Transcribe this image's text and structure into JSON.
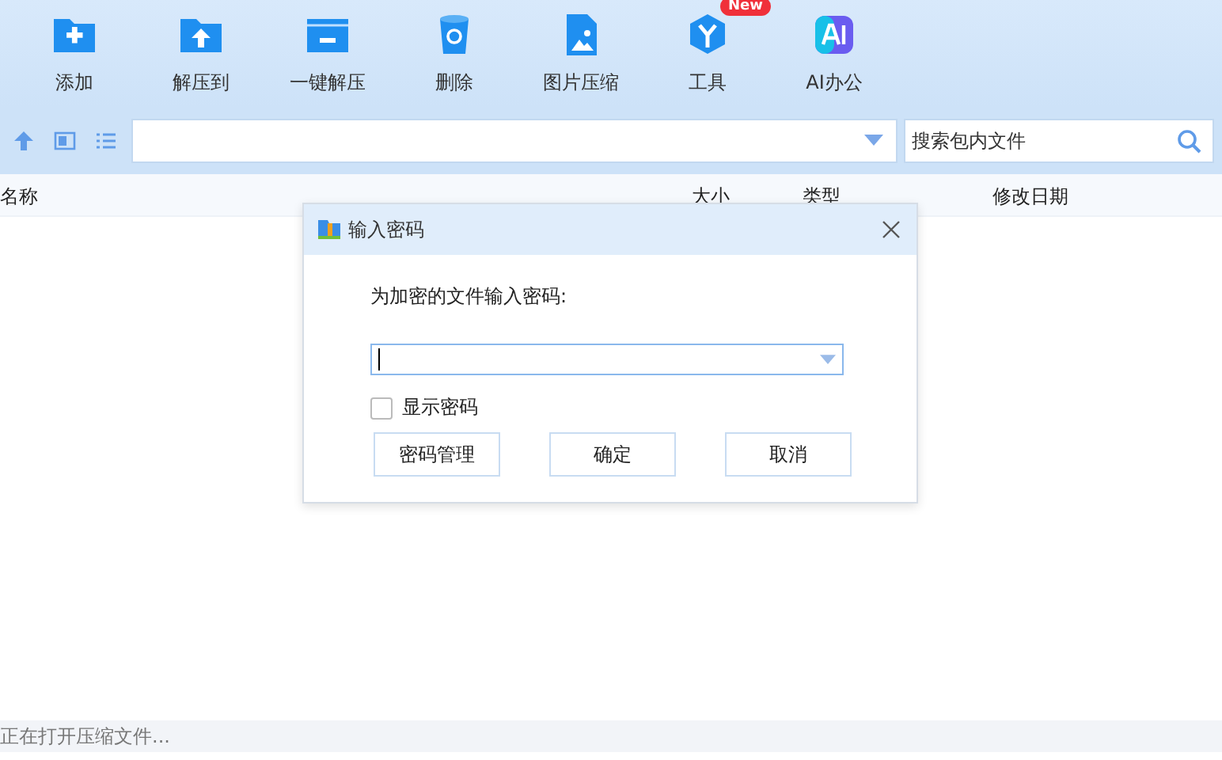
{
  "toolbar": [
    {
      "label": "添加"
    },
    {
      "label": "解压到"
    },
    {
      "label": "一键解压"
    },
    {
      "label": "删除"
    },
    {
      "label": "图片压缩"
    },
    {
      "label": "工具",
      "badge": "New"
    },
    {
      "label": "AI办公"
    }
  ],
  "search": {
    "placeholder": "搜索包内文件"
  },
  "table": {
    "columns": [
      "名称",
      "大小",
      "类型",
      "修改日期"
    ]
  },
  "dialog": {
    "title": "输入密码",
    "prompt": "为加密的文件输入密码:",
    "show_password": {
      "label": "显示密码",
      "checked": false
    },
    "buttons": [
      "密码管理",
      "确定",
      "取消"
    ]
  },
  "status_bar": "正在打开压缩文件..."
}
